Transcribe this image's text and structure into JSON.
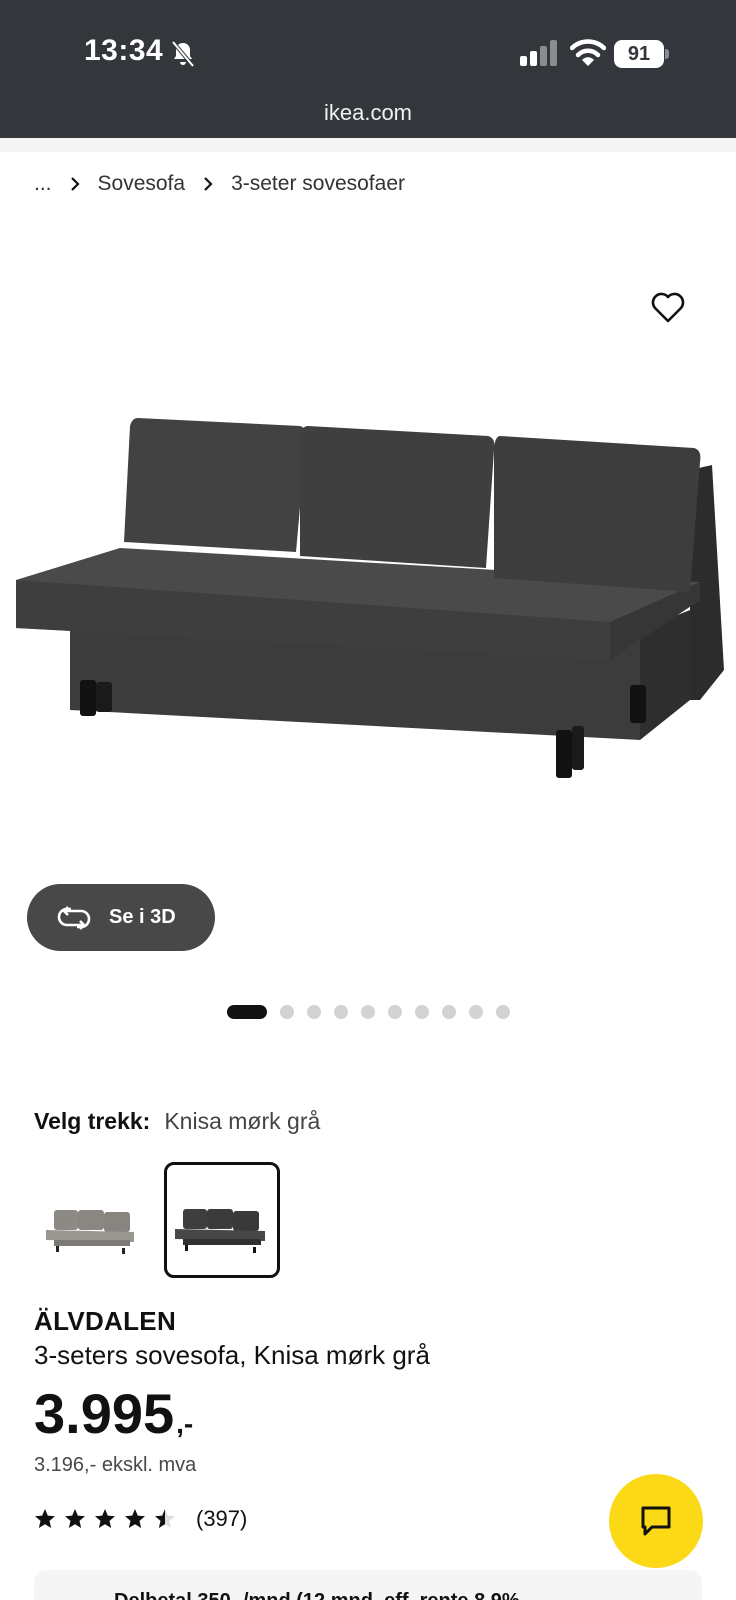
{
  "status_bar": {
    "time": "13:34",
    "battery": "91",
    "url": "ikea.com"
  },
  "breadcrumb": {
    "items": [
      "...",
      "Sovesofa",
      "3-seter sovesofaer"
    ]
  },
  "gallery": {
    "view_3d_label": "Se i 3D",
    "dot_count": 10,
    "active_dot": 0
  },
  "variant": {
    "label": "Velg trekk:",
    "value": "Knisa mørk grå",
    "options": [
      "light-grey",
      "dark-grey"
    ],
    "selected_index": 1
  },
  "product": {
    "brand": "ÄLVDALEN",
    "description": "3-seters sovesofa, Knisa mørk grå",
    "price": "3.995",
    "price_suffix": ",-",
    "price_ex_vat": "3.196,- ekskl. mva",
    "rating_value": 4.5,
    "rating_count": "(397)"
  },
  "finance_banner": {
    "text": "Delbetal 350,-/mnd (12 mnd, eff. rente 8,9%"
  },
  "colors": {
    "status_bg": "#33373b",
    "chat_yellow": "#fcd917",
    "button_dark": "#484848"
  },
  "icons": {
    "favorite": "heart-icon",
    "chat": "chat-icon",
    "rotate": "rotate-3d-icon"
  }
}
